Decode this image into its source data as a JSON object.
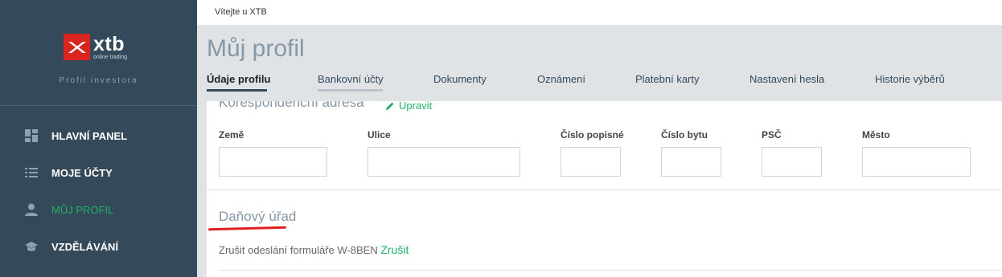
{
  "sidebar": {
    "logo": {
      "brand": "xtb",
      "sub": "online trading"
    },
    "caption": "Profil investora",
    "items": [
      {
        "label": "HLAVNÍ PANEL",
        "icon": "dashboard-icon",
        "active": false
      },
      {
        "label": "MOJE ÚČTY",
        "icon": "list-icon",
        "active": false
      },
      {
        "label": "MŮJ PROFIL",
        "icon": "person-icon",
        "active": true
      },
      {
        "label": "VZDĚLÁVÁNÍ",
        "icon": "graduation-cap-icon",
        "active": false
      }
    ]
  },
  "topbar": {
    "welcome": "Vítejte u XTB"
  },
  "header": {
    "title": "Můj profil",
    "tabs": [
      {
        "label": "Údaje profilu",
        "active": true
      },
      {
        "label": "Bankovní účty",
        "active": false
      },
      {
        "label": "Dokumenty",
        "active": false
      },
      {
        "label": "Oznámení",
        "active": false
      },
      {
        "label": "Platební karty",
        "active": false
      },
      {
        "label": "Nastavení hesla",
        "active": false
      },
      {
        "label": "Historie výběrů",
        "active": false
      }
    ]
  },
  "address": {
    "title": "Korespondenční adresa",
    "edit_label": "Upravit",
    "fields": [
      {
        "label": "Země",
        "value": ""
      },
      {
        "label": "Ulice",
        "value": ""
      },
      {
        "label": "Číslo popisné",
        "value": ""
      },
      {
        "label": "Číslo bytu",
        "value": ""
      },
      {
        "label": "PSČ",
        "value": ""
      },
      {
        "label": "Město",
        "value": ""
      }
    ]
  },
  "tax": {
    "title": "Daňový úřad",
    "cancel_text": "Zrušit odeslání formuláře W-8BEN",
    "cancel_link": "Zrušit"
  },
  "colors": {
    "sidebar_bg": "#34495a",
    "accent_green": "#23b06a",
    "brand_red": "#d9251d",
    "annotation_red": "#e02020"
  }
}
